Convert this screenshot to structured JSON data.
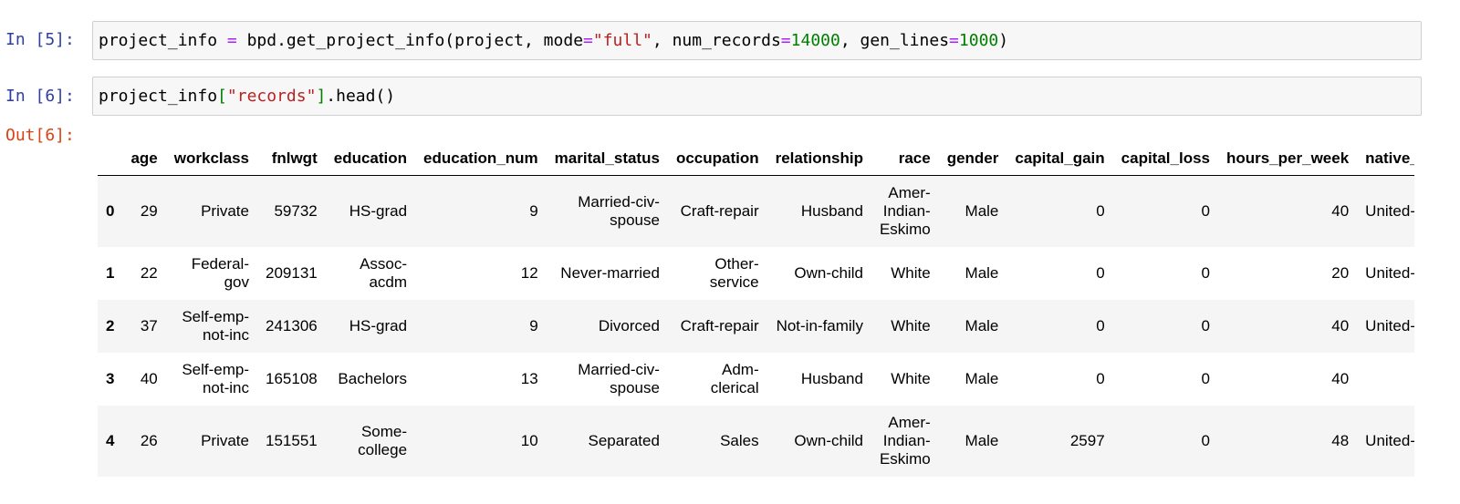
{
  "cells": [
    {
      "prompt": "In [5]:",
      "code_tokens": [
        {
          "t": "project_info ",
          "c": ""
        },
        {
          "t": "=",
          "c": "op"
        },
        {
          "t": " bpd.get_project_info(project, mode",
          "c": ""
        },
        {
          "t": "=",
          "c": "op"
        },
        {
          "t": "\"full\"",
          "c": "str"
        },
        {
          "t": ", num_records",
          "c": ""
        },
        {
          "t": "=",
          "c": "op"
        },
        {
          "t": "14000",
          "c": "num"
        },
        {
          "t": ", gen_lines",
          "c": ""
        },
        {
          "t": "=",
          "c": "op"
        },
        {
          "t": "1000",
          "c": "num"
        },
        {
          "t": ")",
          "c": ""
        }
      ]
    },
    {
      "prompt": "In [6]:",
      "code_tokens": [
        {
          "t": "project_info",
          "c": ""
        },
        {
          "t": "[",
          "c": "num"
        },
        {
          "t": "\"records\"",
          "c": "str"
        },
        {
          "t": "]",
          "c": "num"
        },
        {
          "t": ".head()",
          "c": ""
        }
      ]
    }
  ],
  "output": {
    "prompt": "Out[6]:",
    "columns": [
      "",
      "age",
      "workclass",
      "fnlwgt",
      "education",
      "education_num",
      "marital_status",
      "occupation",
      "relationship",
      "race",
      "gender",
      "capital_gain",
      "capital_loss",
      "hours_per_week",
      "native_country"
    ],
    "rows": [
      [
        "0",
        "29",
        "Private",
        "59732",
        "HS-grad",
        "9",
        "Married-civ-spouse",
        "Craft-repair",
        "Husband",
        "Amer-Indian-Eskimo",
        "Male",
        "0",
        "0",
        "40",
        "United-States"
      ],
      [
        "1",
        "22",
        "Federal-gov",
        "209131",
        "Assoc-acdm",
        "12",
        "Never-married",
        "Other-service",
        "Own-child",
        "White",
        "Male",
        "0",
        "0",
        "20",
        "United-States"
      ],
      [
        "2",
        "37",
        "Self-emp-not-inc",
        "241306",
        "HS-grad",
        "9",
        "Divorced",
        "Craft-repair",
        "Not-in-family",
        "White",
        "Male",
        "0",
        "0",
        "40",
        "United-States"
      ],
      [
        "3",
        "40",
        "Self-emp-not-inc",
        "165108",
        "Bachelors",
        "13",
        "Married-civ-spouse",
        "Adm-clerical",
        "Husband",
        "White",
        "Male",
        "0",
        "0",
        "40",
        ""
      ],
      [
        "4",
        "26",
        "Private",
        "151551",
        "Some-college",
        "10",
        "Separated",
        "Sales",
        "Own-child",
        "Amer-Indian-Eskimo",
        "Male",
        "2597",
        "0",
        "48",
        "United-States"
      ]
    ]
  }
}
